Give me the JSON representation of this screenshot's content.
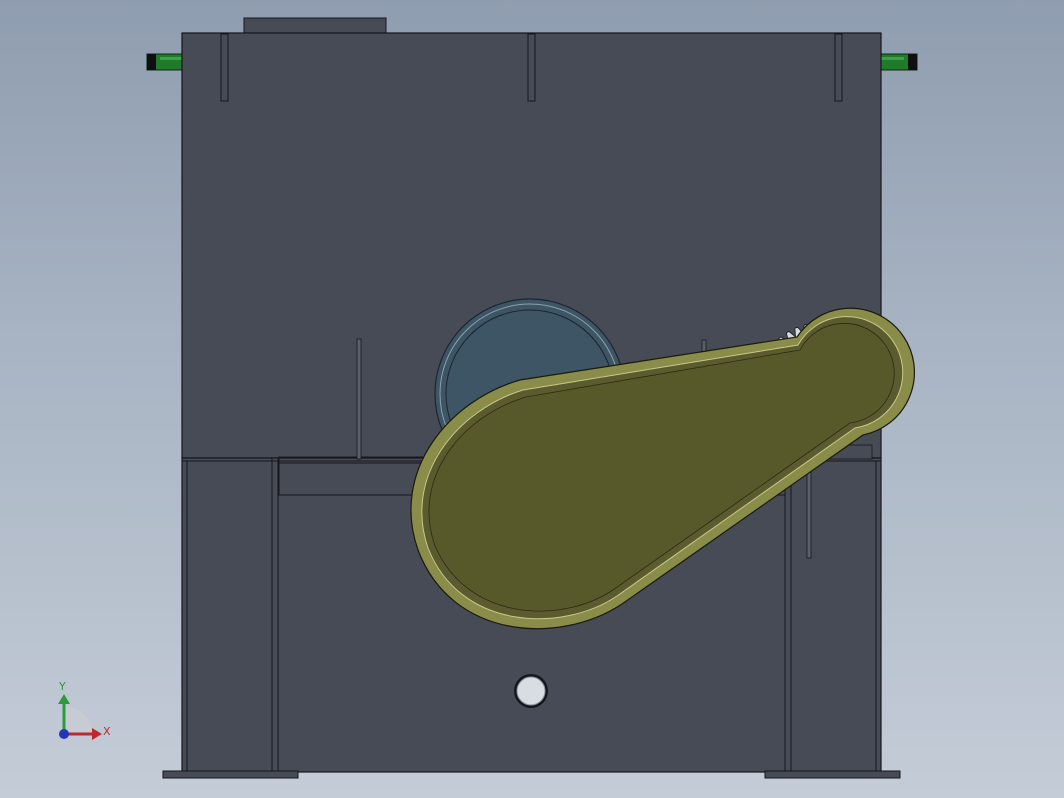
{
  "viewport": {
    "background_top": "#8f9db0",
    "background_bottom": "#c4ccd7"
  },
  "model": {
    "body_color": "#474b56",
    "edge_color": "#15171c",
    "belt_guard_color": "#5a5b2e",
    "belt_guard_edge": "#c9c98a",
    "pulley_color": "#3e5565",
    "handle_color": "#1f7a2a",
    "gear_color": "#d7dbe0"
  },
  "triad": {
    "x_label": "X",
    "y_label": "Y",
    "x_color": "#c0262d",
    "y_color": "#2b9c3a",
    "z_color": "#2236b8"
  }
}
